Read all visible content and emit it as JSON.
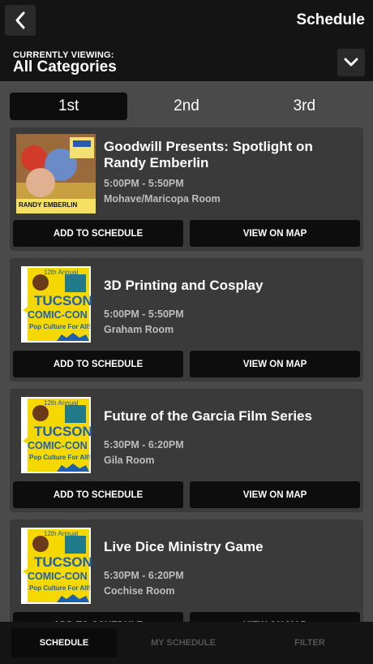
{
  "header": {
    "title": "Schedule",
    "viewing_label": "CURRENTLY VIEWING:",
    "viewing_value": "All Categories"
  },
  "tabs": [
    {
      "label": "1st",
      "active": true
    },
    {
      "label": "2nd",
      "active": false
    },
    {
      "label": "3rd",
      "active": false
    }
  ],
  "events": [
    {
      "title": "Goodwill Presents: Spotlight on Randy Emberlin",
      "time": "5:00PM - 5:50PM",
      "room": "Mohave/Maricopa Room",
      "image": "randy-emberlin-poster",
      "image_text": "RANDY EMBERLIN",
      "add_label": "ADD TO SCHEDULE",
      "map_label": "VIEW ON MAP"
    },
    {
      "title": "3D Printing and Cosplay",
      "time": "5:00PM - 5:50PM",
      "room": "Graham Room",
      "image": "tucson-comic-con-logo",
      "add_label": "ADD TO SCHEDULE",
      "map_label": "VIEW ON MAP"
    },
    {
      "title": "Future of the Garcia Film Series",
      "time": "5:30PM - 6:20PM",
      "room": "Gila Room",
      "image": "tucson-comic-con-logo",
      "add_label": "ADD TO SCHEDULE",
      "map_label": "VIEW ON MAP"
    },
    {
      "title": "Live Dice Ministry Game",
      "time": "5:30PM - 6:20PM",
      "room": "Cochise Room",
      "image": "tucson-comic-con-logo",
      "add_label": "ADD TO SCHEDULE",
      "map_label": "VIEW ON MAP"
    }
  ],
  "logo_text": {
    "line1": "12th Annual",
    "line2": "TUCSON",
    "line3": "COMIC-CON",
    "line4": "Pop Culture For All!"
  },
  "bottom_nav": [
    {
      "label": "SCHEDULE",
      "active": true
    },
    {
      "label": "MY SCHEDULE",
      "active": false
    },
    {
      "label": "FILTER",
      "active": false
    }
  ],
  "icons": {
    "back": "chevron-left-icon",
    "dropdown": "chevron-down-icon"
  },
  "colors": {
    "header_bg": "#141414",
    "content_bg": "#4a4a4a",
    "card_bg": "#3a3a3a",
    "button_bg": "#0d0d0d",
    "logo_yellow": "#f5d800",
    "logo_blue": "#1f5fb0"
  }
}
